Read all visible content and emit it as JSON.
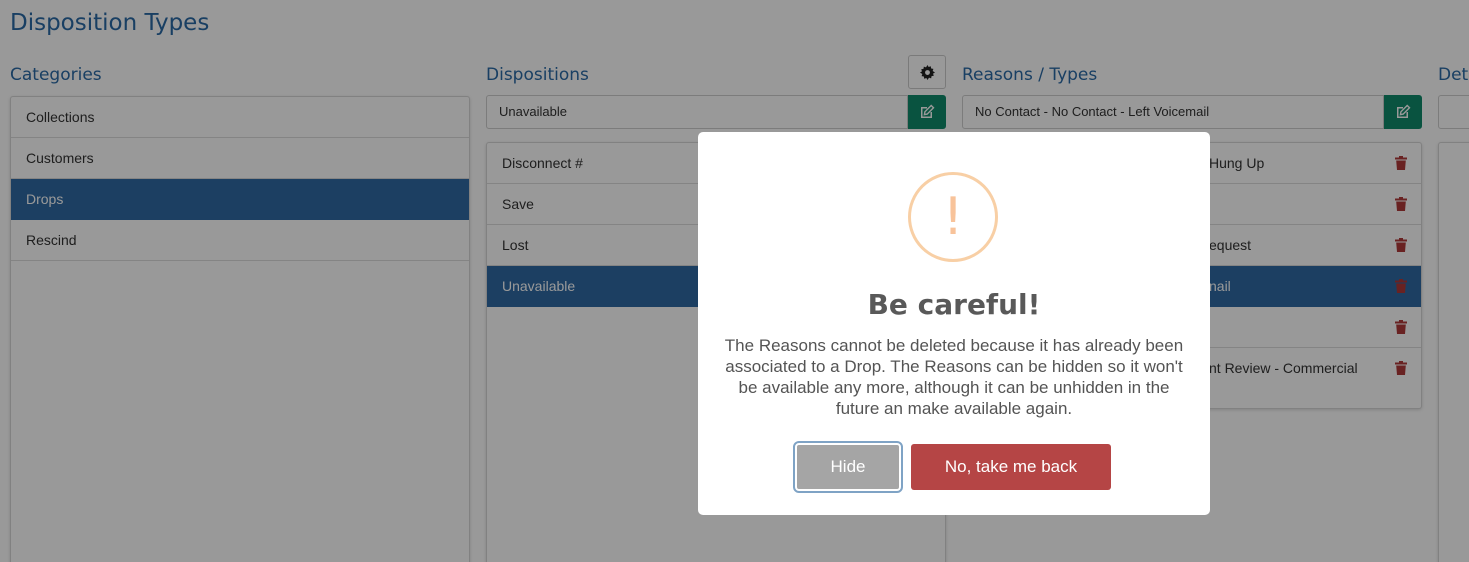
{
  "page": {
    "title": "Disposition Types"
  },
  "columns": {
    "categories": {
      "title": "Categories",
      "items": [
        {
          "label": "Collections",
          "selected": false
        },
        {
          "label": "Customers",
          "selected": false
        },
        {
          "label": "Drops",
          "selected": true
        },
        {
          "label": "Rescind",
          "selected": false
        }
      ]
    },
    "dispositions": {
      "title": "Dispositions",
      "field_value": "Unavailable",
      "items": [
        {
          "label": "Disconnect #",
          "selected": false
        },
        {
          "label": "Save",
          "selected": false
        },
        {
          "label": "Lost",
          "selected": false
        },
        {
          "label": "Unavailable",
          "selected": true
        }
      ]
    },
    "reasons": {
      "title": "Reasons / Types",
      "field_value": "No Contact - No Contact - Left Voicemail",
      "items": [
        {
          "label": "Hung Up",
          "selected": false
        },
        {
          "label": "",
          "selected": false
        },
        {
          "label": "equest",
          "selected": false
        },
        {
          "label": "nail",
          "selected": true
        },
        {
          "label": "",
          "selected": false
        },
        {
          "label": "nt Review - Commercial",
          "selected": false
        }
      ]
    },
    "details": {
      "title": "Det"
    }
  },
  "icons": {
    "gear": "gear-icon",
    "edit": "edit-icon",
    "trash": "trash-icon",
    "warning": "warning-icon"
  },
  "modal": {
    "icon_glyph": "!",
    "title": "Be careful!",
    "message": "The Reasons cannot be deleted because it has already been associated to a Drop. The Reasons can be hidden so it won't be available any more, although it can be unhidden in the future an make available again.",
    "hide_label": "Hide",
    "back_label": "No, take me back"
  },
  "colors": {
    "accent": "#2a6aa6",
    "selected_row": "#2f6aa3",
    "edit_button": "#0f8a6b",
    "danger": "#b54545",
    "trash": "#b03a3a",
    "warning": "#f8cfa5"
  }
}
